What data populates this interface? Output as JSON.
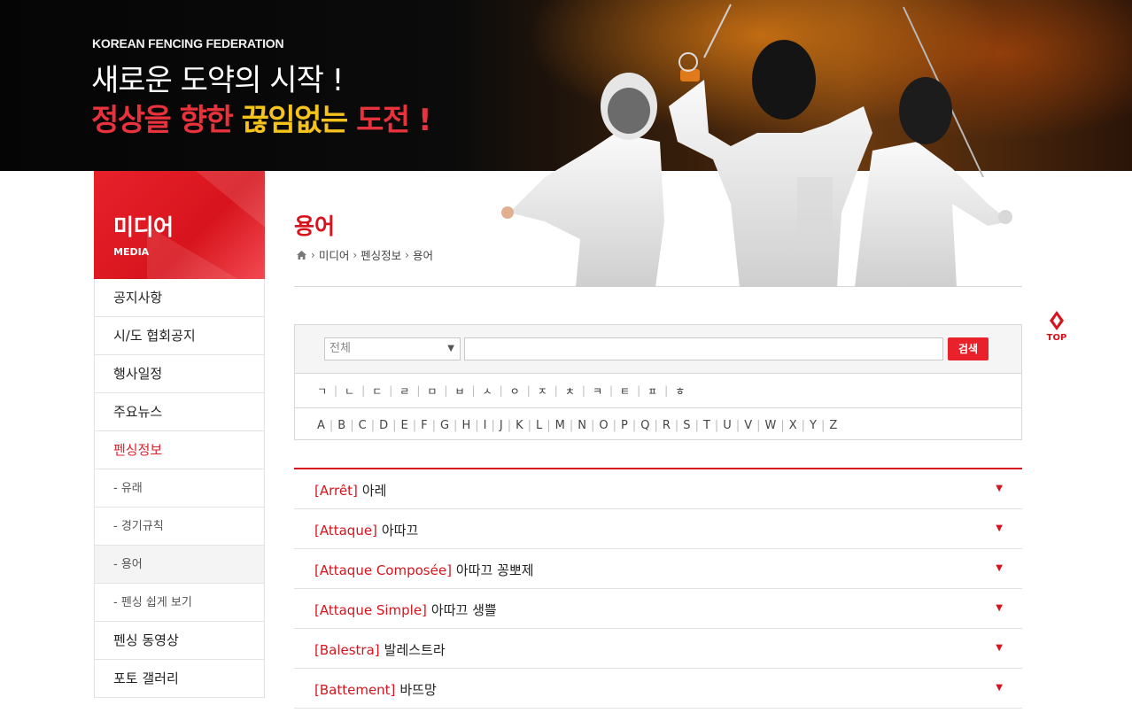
{
  "banner": {
    "org": "KOREAN FENCING FEDERATION",
    "line1": "새로운 도약의 시작 !",
    "line2_red": "정상을 향한",
    "line2_yellow": "끊임없는",
    "line2_red2": "도전 !"
  },
  "sidebar": {
    "title": "미디어",
    "subtitle": "MEDIA",
    "items": [
      {
        "label": "공지사항"
      },
      {
        "label": "시/도 협회공지"
      },
      {
        "label": "행사일정"
      },
      {
        "label": "주요뉴스"
      },
      {
        "label": "펜싱정보",
        "selected": true
      },
      {
        "label": "- 유래",
        "sub": true
      },
      {
        "label": "- 경기규칙",
        "sub": true
      },
      {
        "label": "- 용어",
        "sub": true,
        "active": true
      },
      {
        "label": "- 펜싱 쉽게 보기",
        "sub": true
      },
      {
        "label": "펜싱 동영상"
      },
      {
        "label": "포토 갤러리"
      }
    ]
  },
  "page": {
    "title": "용어",
    "breadcrumb": [
      "미디어",
      "펜싱정보",
      "용어"
    ]
  },
  "top_button": {
    "label": "TOP"
  },
  "search": {
    "select_value": "전체",
    "input_value": "",
    "button_label": "검색"
  },
  "initials_ko": [
    "ㄱ",
    "ㄴ",
    "ㄷ",
    "ㄹ",
    "ㅁ",
    "ㅂ",
    "ㅅ",
    "ㅇ",
    "ㅈ",
    "ㅊ",
    "ㅋ",
    "ㅌ",
    "ㅍ",
    "ㅎ"
  ],
  "initials_en": [
    "A",
    "B",
    "C",
    "D",
    "E",
    "F",
    "G",
    "H",
    "I",
    "J",
    "K",
    "L",
    "M",
    "N",
    "O",
    "P",
    "Q",
    "R",
    "S",
    "T",
    "U",
    "V",
    "W",
    "X",
    "Y",
    "Z"
  ],
  "terms": [
    {
      "fr": "[Arrêt]",
      "ko": "아레"
    },
    {
      "fr": "[Attaque]",
      "ko": "아따끄"
    },
    {
      "fr": "[Attaque Composée]",
      "ko": "아따끄 꽁뽀제"
    },
    {
      "fr": "[Attaque Simple]",
      "ko": "아따끄 생쁠"
    },
    {
      "fr": "[Balestra]",
      "ko": "발레스트라"
    },
    {
      "fr": "[Battement]",
      "ko": "바뜨망"
    }
  ],
  "colors": {
    "accent": "#d7141d",
    "banner_yellow": "#f5c31c"
  },
  "icons": {
    "home": "home-icon",
    "expand": "triangle-down-icon",
    "top": "top-arrow-icon"
  }
}
